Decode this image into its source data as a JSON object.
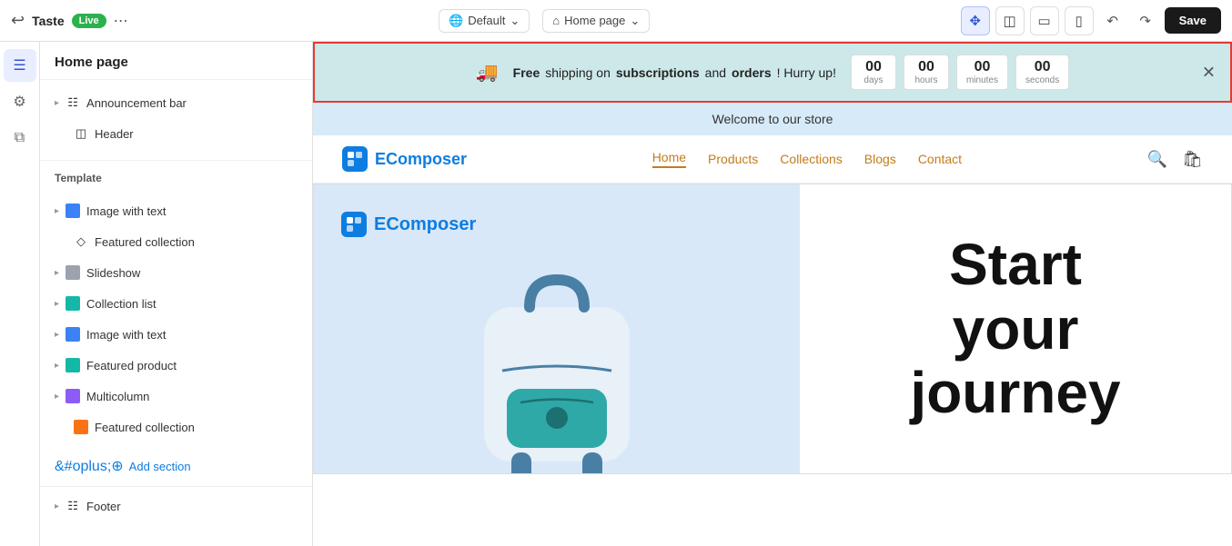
{
  "topbar": {
    "app_name": "Taste",
    "live_label": "Live",
    "domain": "Default",
    "page": "Home page",
    "save_label": "Save"
  },
  "sidebar": {
    "title": "Home page",
    "sections": {
      "fixed": [
        {
          "id": "announcement-bar",
          "label": "Announcement bar",
          "indent": true
        },
        {
          "id": "header",
          "label": "Header",
          "indent": true
        }
      ],
      "template_label": "Template",
      "template": [
        {
          "id": "image-with-text-1",
          "label": "Image with text",
          "has_chevron": true,
          "icon_color": "blue"
        },
        {
          "id": "featured-collection-1",
          "label": "Featured collection",
          "has_chevron": false,
          "icon_color": "gray"
        },
        {
          "id": "slideshow",
          "label": "Slideshow",
          "has_chevron": true,
          "icon_color": "gray"
        },
        {
          "id": "collection-list",
          "label": "Collection list",
          "has_chevron": true,
          "icon_color": "teal"
        },
        {
          "id": "image-with-text-2",
          "label": "Image with text",
          "has_chevron": true,
          "icon_color": "blue"
        },
        {
          "id": "featured-product",
          "label": "Featured product",
          "has_chevron": true,
          "icon_color": "teal"
        },
        {
          "id": "multicolumn",
          "label": "Multicolumn",
          "has_chevron": true,
          "icon_color": "purple"
        },
        {
          "id": "featured-collection-2",
          "label": "Featured collection",
          "has_chevron": false,
          "icon_color": "orange"
        }
      ],
      "add_section_label": "Add section",
      "footer": [
        {
          "id": "footer",
          "label": "Footer",
          "has_chevron": true
        }
      ]
    }
  },
  "announcement": {
    "message_pre": "Free",
    "message_mid": "shipping on",
    "message_bold1": "subscriptions",
    "message_and": "and",
    "message_bold2": "orders",
    "message_end": "! Hurry up!",
    "countdown": {
      "days": "00",
      "hours": "00",
      "minutes": "00",
      "seconds": "00",
      "days_label": "days",
      "hours_label": "hours",
      "minutes_label": "minutes",
      "seconds_label": "seconds"
    }
  },
  "store_banner": "Welcome to our store",
  "nav": {
    "logo_text": "EComposer",
    "links": [
      "Home",
      "Products",
      "Collections",
      "Blogs",
      "Contact"
    ]
  },
  "hero": {
    "logo_text": "EComposer",
    "headline_line1": "Start",
    "headline_line2": "your",
    "headline_line3": "journey"
  }
}
